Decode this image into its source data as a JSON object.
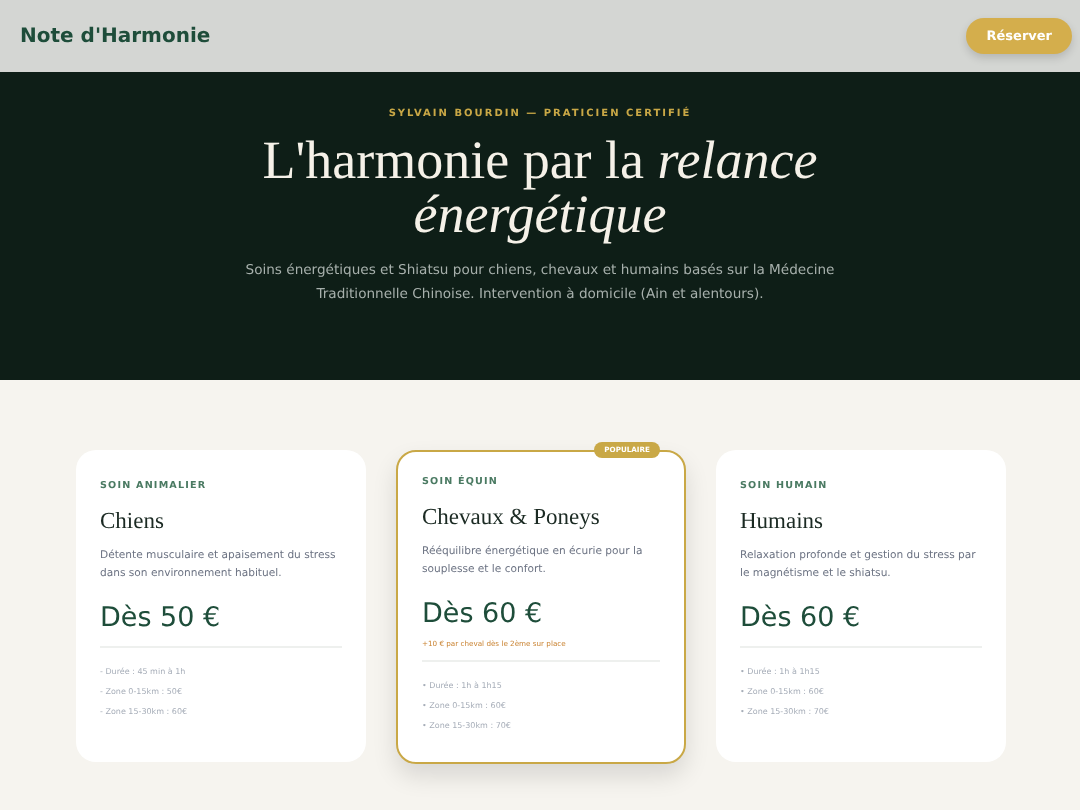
{
  "header": {
    "brand": "Note d'Harmonie",
    "cta": "Réserver"
  },
  "hero": {
    "eyebrow": "SYLVAIN BOURDIN — PRATICIEN CERTIFIÉ",
    "title": "L'harmonie par la *relance énergétique*",
    "lead": "Soins énergétiques et Shiatsu pour chiens, chevaux et humains basés sur la Médecine Traditionnelle Chinoise. Intervention à domicile (Ain et alentours)."
  },
  "cards": [
    {
      "featured": false,
      "category": "SOIN ANIMALIER",
      "title": "Chiens",
      "description": "Détente musculaire et apaisement du stress dans son environnement habituel.",
      "price": "Dès 50 €",
      "details": [
        "- Durée : 45 min à 1h",
        "- Zone 0-15km : 50€",
        "- Zone 15-30km : 60€"
      ]
    },
    {
      "featured": true,
      "badge": "POPULAIRE",
      "category": "SOIN ÉQUIN",
      "title": "Chevaux & Poneys",
      "description": "Rééquilibre énergétique en écurie pour la souplesse et le confort.",
      "price": "Dès 60 €",
      "note": "+10 € par cheval dès le 2ème sur place",
      "details": [
        "• Durée : 1h à 1h15",
        "• Zone 0-15km : 60€",
        "• Zone 15-30km : 70€"
      ]
    },
    {
      "featured": false,
      "category": "SOIN HUMAIN",
      "title": "Humains",
      "description": "Relaxation profonde et gestion du stress par le magnétisme et le shiatsu.",
      "price": "Dès 60 €",
      "details": [
        "• Durée : 1h à 1h15",
        "• Zone 0-15km : 60€",
        "• Zone 15-30km : 70€"
      ]
    }
  ]
}
